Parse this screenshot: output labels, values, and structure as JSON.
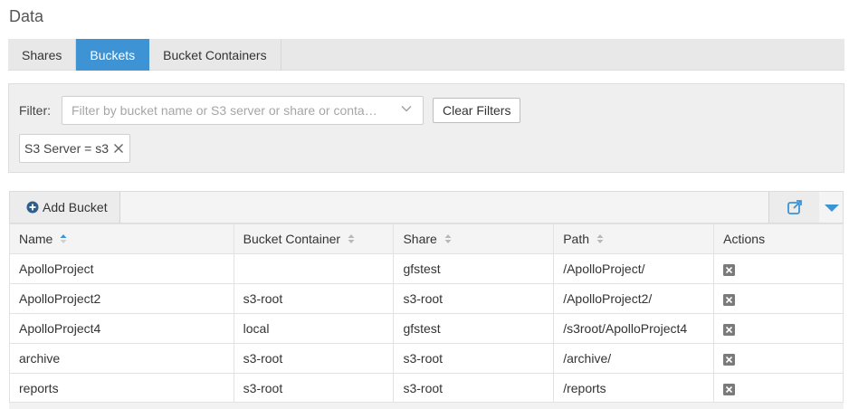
{
  "page": {
    "title": "Data"
  },
  "tabs": [
    {
      "label": "Shares",
      "active": false
    },
    {
      "label": "Buckets",
      "active": true
    },
    {
      "label": "Bucket Containers",
      "active": false
    }
  ],
  "filter": {
    "label": "Filter:",
    "placeholder": "Filter by bucket name or S3 server or share or conta…",
    "value": "",
    "clear_label": "Clear Filters",
    "chips": [
      {
        "label": "S3 Server = s3"
      }
    ]
  },
  "toolbar": {
    "add_label": "Add Bucket"
  },
  "table": {
    "columns": [
      {
        "label": "Name",
        "sort": "asc"
      },
      {
        "label": "Bucket Container",
        "sort": "none"
      },
      {
        "label": "Share",
        "sort": "none"
      },
      {
        "label": "Path",
        "sort": "none"
      },
      {
        "label": "Actions",
        "sort": null
      }
    ],
    "rows": [
      {
        "name": "ApolloProject",
        "container": "",
        "share": "gfstest",
        "path": "/ApolloProject/"
      },
      {
        "name": "ApolloProject2",
        "container": "s3-root",
        "share": "s3-root",
        "path": "/ApolloProject2/"
      },
      {
        "name": "ApolloProject4",
        "container": "local",
        "share": "gfstest",
        "path": "/s3root/ApolloProject4"
      },
      {
        "name": "archive",
        "container": "s3-root",
        "share": "s3-root",
        "path": "/archive/"
      },
      {
        "name": "reports",
        "container": "s3-root",
        "share": "s3-root",
        "path": "/reports"
      }
    ]
  },
  "colors": {
    "accent": "#3d93d4",
    "tab_bar": "#e8e8e8",
    "panel": "#efefef",
    "icon_grey": "#7a7a7a"
  },
  "icons": {
    "add": "plus-circle-icon",
    "export": "external-link-icon",
    "menu": "caret-down-icon",
    "delete": "close-square-icon",
    "chip_remove": "close-icon",
    "dropdown": "chevron-down-icon"
  }
}
